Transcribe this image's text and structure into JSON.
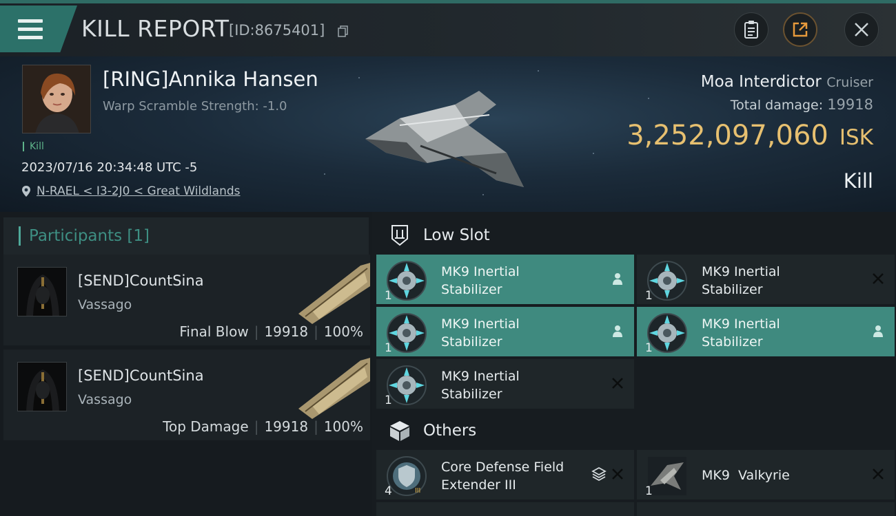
{
  "header": {
    "title": "KILL REPORT",
    "report_id": "[ID:8675401]"
  },
  "victim": {
    "name": "[RING]Annika Hansen",
    "warp_scramble": "Warp Scramble Strength: -1.0",
    "kill_tag": "Kill",
    "timestamp": "2023/07/16 20:34:48 UTC -5",
    "location": "N-RAEL < I3-2J0 < Great Wildlands"
  },
  "ship": {
    "name": "Moa Interdictor",
    "class": "Cruiser",
    "total_damage_label": "Total damage:",
    "total_damage_value": "19918",
    "isk_value": "3,252,097,060",
    "isk_unit": "ISK",
    "result": "Kill"
  },
  "participants": {
    "header": "Participants [1]",
    "list": [
      {
        "name": "[SEND]CountSina",
        "ship": "Vassago",
        "role": "Final Blow",
        "damage": "19918",
        "percent": "100%"
      },
      {
        "name": "[SEND]CountSina",
        "ship": "Vassago",
        "role": "Top Damage",
        "damage": "19918",
        "percent": "100%"
      }
    ]
  },
  "low_slot": {
    "header": "Low Slot",
    "modules": [
      {
        "line1": "MK9 Inertial",
        "line2": "Stabilizer",
        "qty": "1",
        "state": "fitted"
      },
      {
        "line1": "MK9 Inertial",
        "line2": "Stabilizer",
        "qty": "1",
        "state": "destroyed"
      },
      {
        "line1": "MK9 Inertial",
        "line2": "Stabilizer",
        "qty": "1",
        "state": "fitted"
      },
      {
        "line1": "MK9 Inertial",
        "line2": "Stabilizer",
        "qty": "1",
        "state": "fitted"
      },
      {
        "line1": "MK9 Inertial",
        "line2": "Stabilizer",
        "qty": "1",
        "state": "destroyed"
      }
    ]
  },
  "others": {
    "header": "Others",
    "modules": [
      {
        "line1": "Core Defense Field",
        "line2": "Extender III",
        "qty": "4",
        "state": "destroyed"
      },
      {
        "line1": "MK9  Valkyrie",
        "line2": "",
        "qty": "1",
        "state": "destroyed"
      }
    ]
  },
  "colors": {
    "accent_teal": "#3f8a7f",
    "isk_gold": "#e7c070",
    "kill_green": "#5fb58b"
  }
}
